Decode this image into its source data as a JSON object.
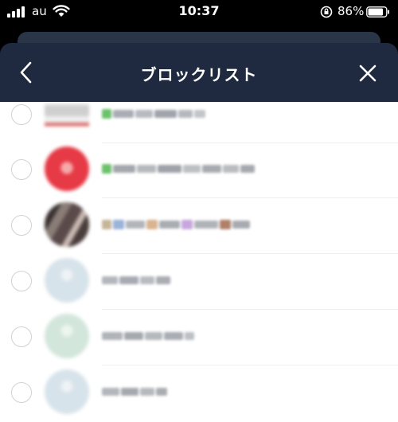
{
  "status_bar": {
    "carrier": "au",
    "time": "10:37",
    "battery_percent": "86%"
  },
  "header": {
    "title": "ブロックリスト"
  },
  "colors": {
    "header_bg": "#1f2a40",
    "list_bg": "#ffffff",
    "radio_border": "#d2d2d2"
  },
  "list": {
    "items": [
      {
        "selected": false
      },
      {
        "selected": false
      },
      {
        "selected": false
      },
      {
        "selected": false
      },
      {
        "selected": false
      },
      {
        "selected": false
      }
    ]
  }
}
